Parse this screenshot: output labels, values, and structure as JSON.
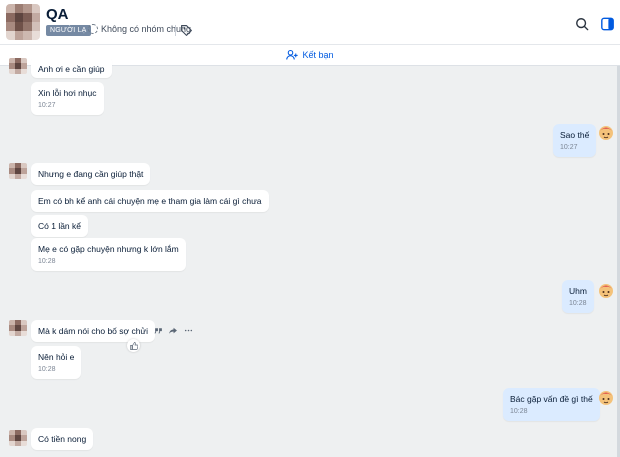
{
  "header": {
    "title": "QA",
    "badge": "NGƯỜI LẠ",
    "group_status": "Không có nhóm chung"
  },
  "friend_bar": {
    "label": "Kết bạn"
  },
  "messages": [
    {
      "text": "Anh ơi e cần giúp",
      "time": ""
    },
    {
      "text": "Xin lỗi hơi nhục",
      "time": "10:27"
    },
    {
      "text": "Sao thế",
      "time": "10:27"
    },
    {
      "text": "Nhưng e đang cần giúp thật",
      "time": ""
    },
    {
      "text": "Em có bh kể anh cái chuyện mẹ e tham gia làm cái gì chưa",
      "time": ""
    },
    {
      "text": "Có 1 lần kể",
      "time": ""
    },
    {
      "text": "Mẹ e có gặp chuyện nhưng k lớn lắm",
      "time": "10:28"
    },
    {
      "text": "Uhm",
      "time": "10:28"
    },
    {
      "text": "Mà k dám nói cho bố sợ chửi",
      "time": ""
    },
    {
      "text": "Nên hỏi e",
      "time": "10:28"
    },
    {
      "text": "Bác gặp vấn đề gì thế",
      "time": "10:28"
    },
    {
      "text": "Có tiền nong",
      "time": ""
    }
  ],
  "colors": {
    "background": "#eef0f1",
    "bubble_other": "#ffffff",
    "bubble_self": "#dbebff",
    "accent": "#005ae0"
  },
  "icons": [
    "search-icon",
    "sidebar-toggle-icon",
    "tag-icon",
    "add-friend-icon",
    "quote-icon",
    "share-icon",
    "more-icon",
    "like-icon"
  ]
}
